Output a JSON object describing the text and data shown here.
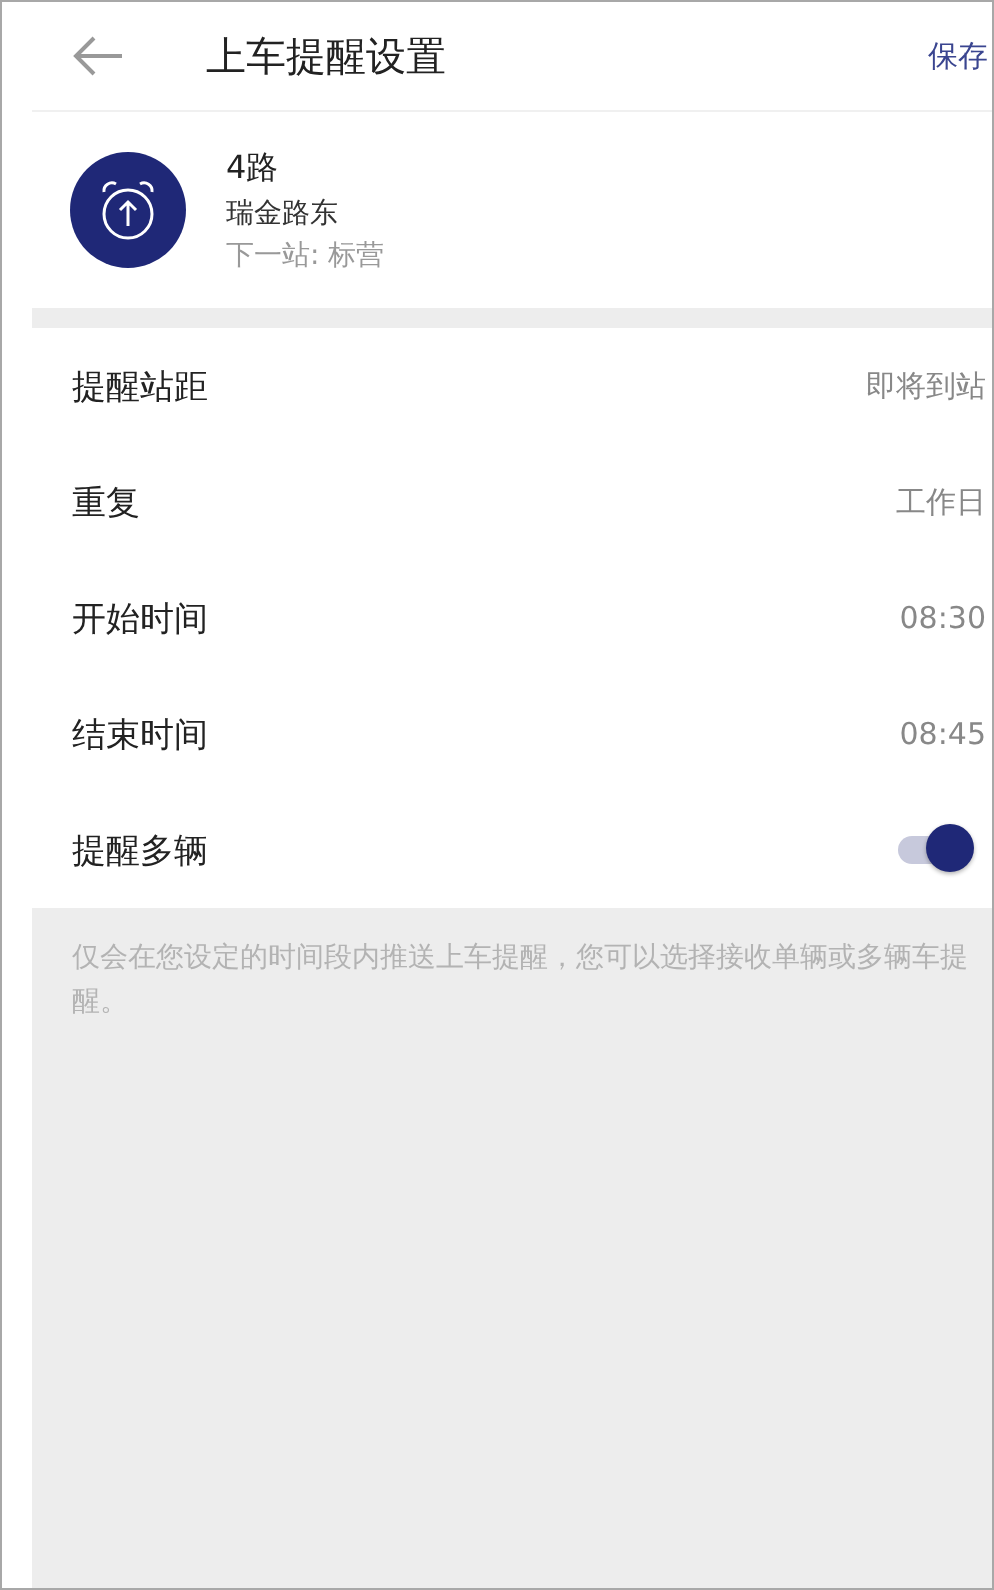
{
  "header": {
    "title": "上车提醒设置",
    "action": "保存"
  },
  "bus": {
    "route": "4路",
    "station": "瑞金路东",
    "next_stop": "下一站: 标营"
  },
  "settings": [
    {
      "kind": "value",
      "label": "提醒站距",
      "value": "即将到站"
    },
    {
      "kind": "value",
      "label": "重复",
      "value": "工作日"
    },
    {
      "kind": "value",
      "label": "开始时间",
      "value": "08:30"
    },
    {
      "kind": "value",
      "label": "结束时间",
      "value": "08:45"
    },
    {
      "kind": "toggle",
      "label": "提醒多辆",
      "on": true
    }
  ],
  "note": "仅会在您设定的时间段内推送上车提醒，您可以选择接收单辆或多辆车提醒。"
}
